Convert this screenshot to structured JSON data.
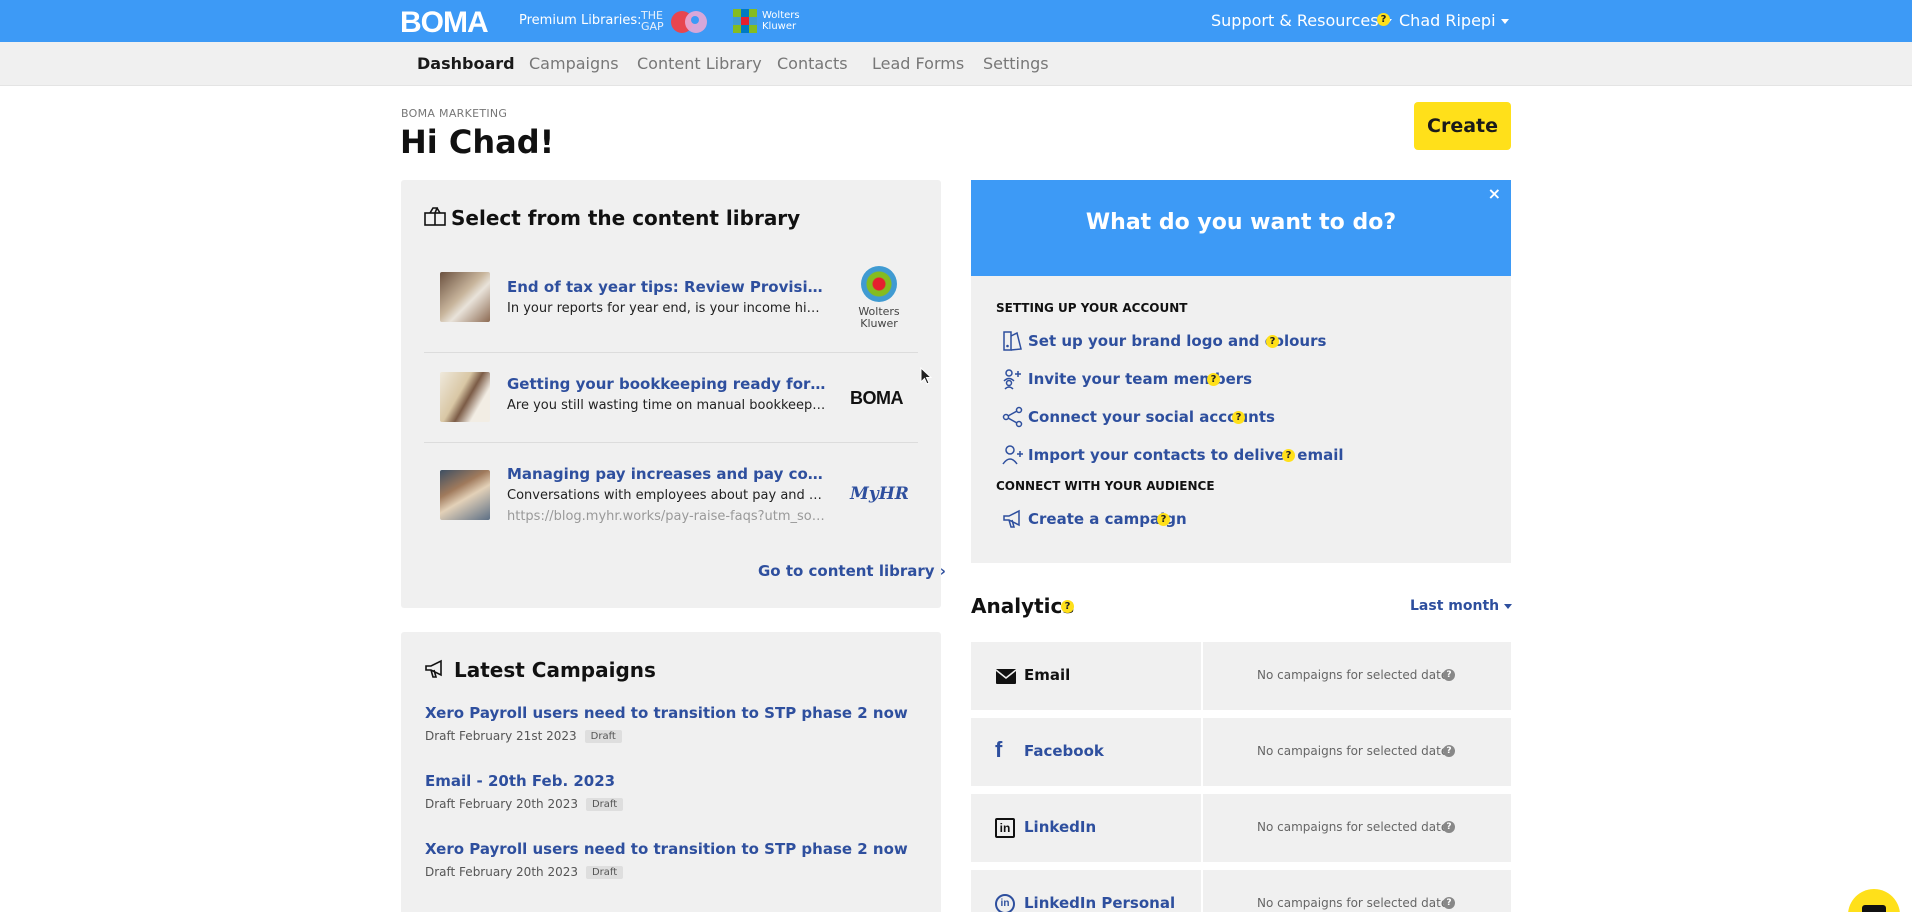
{
  "header": {
    "logo": "BOMA",
    "premium_label": "Premium Libraries:",
    "gap_logo_text": "THE GAP",
    "wk_logo_text_1": "Wolters",
    "wk_logo_text_2": "Kluwer",
    "support_label": "Support & Resources",
    "help_badge": "?",
    "user_label": "Chad Ripepi"
  },
  "nav": {
    "items": [
      {
        "label": "Dashboard",
        "active": true
      },
      {
        "label": "Campaigns"
      },
      {
        "label": "Content Library"
      },
      {
        "label": "Contacts"
      },
      {
        "label": "Lead Forms"
      },
      {
        "label": "Settings"
      }
    ]
  },
  "page": {
    "org_label": "BOMA MARKETING",
    "greeting": "Hi Chad!",
    "create_label": "Create"
  },
  "library": {
    "title": "Select from the content library",
    "items": [
      {
        "title": "End of tax year tips: Review Provisional tax",
        "desc": "In your reports for year end, is your income higher than expected",
        "source": "Wolters Kluwer",
        "source_line1": "Wolters",
        "source_line2": "Kluwer"
      },
      {
        "title": "Getting your bookkeeping ready for a digital future",
        "desc": "Are you still wasting time on manual bookkeeping tasks",
        "source": "BOMA"
      },
      {
        "title": "Managing pay increases and pay conversations",
        "desc": "Conversations with employees about pay and pay increases",
        "url": "https://blog.myhr.works/pay-raise-faqs?utm_source",
        "source": "MyHR"
      }
    ],
    "go_link": "Go to content library ›"
  },
  "campaigns": {
    "title": "Latest Campaigns",
    "items": [
      {
        "title": "Xero Payroll users need to transition to STP phase 2 now",
        "meta": "Draft February 21st 2023",
        "badge": "Draft"
      },
      {
        "title": "Email - 20th Feb. 2023",
        "meta": "Draft February 20th 2023",
        "badge": "Draft"
      },
      {
        "title": "Xero Payroll users need to transition to STP phase 2 now",
        "meta": "Draft February 20th 2023",
        "badge": "Draft"
      }
    ]
  },
  "wdyw": {
    "title": "What do you want to do?",
    "close": "×",
    "section1": "SETTING UP YOUR ACCOUNT",
    "section2": "CONNECT WITH YOUR AUDIENCE",
    "actions": [
      {
        "label": "Set up your brand logo and colours",
        "icon": "brand-palette-icon"
      },
      {
        "label": "Invite your team members",
        "icon": "team-icon"
      },
      {
        "label": "Connect your social accounts",
        "icon": "share-icon"
      },
      {
        "label": "Import your contacts to deliver email",
        "icon": "add-user-icon"
      },
      {
        "label": "Create a campaign",
        "icon": "megaphone-icon"
      }
    ],
    "help": "?"
  },
  "analytics": {
    "title": "Analytics",
    "help": "?",
    "period": "Last month",
    "rows": [
      {
        "label": "Email",
        "status": "No campaigns for selected dates",
        "color": "#111111"
      },
      {
        "label": "Facebook",
        "status": "No campaigns for selected dates",
        "color": "#2e4f9e"
      },
      {
        "label": "LinkedIn",
        "status": "No campaigns for selected dates",
        "color": "#2e4f9e"
      },
      {
        "label": "LinkedIn Personal",
        "status": "No campaigns for selected dates",
        "color": "#2e4f9e"
      }
    ],
    "info": "?"
  },
  "colors": {
    "brand_blue": "#3d9af6",
    "link_blue": "#2e4f9e",
    "accent_yellow": "#ffe01a",
    "card_bg": "#f0f0f0"
  }
}
